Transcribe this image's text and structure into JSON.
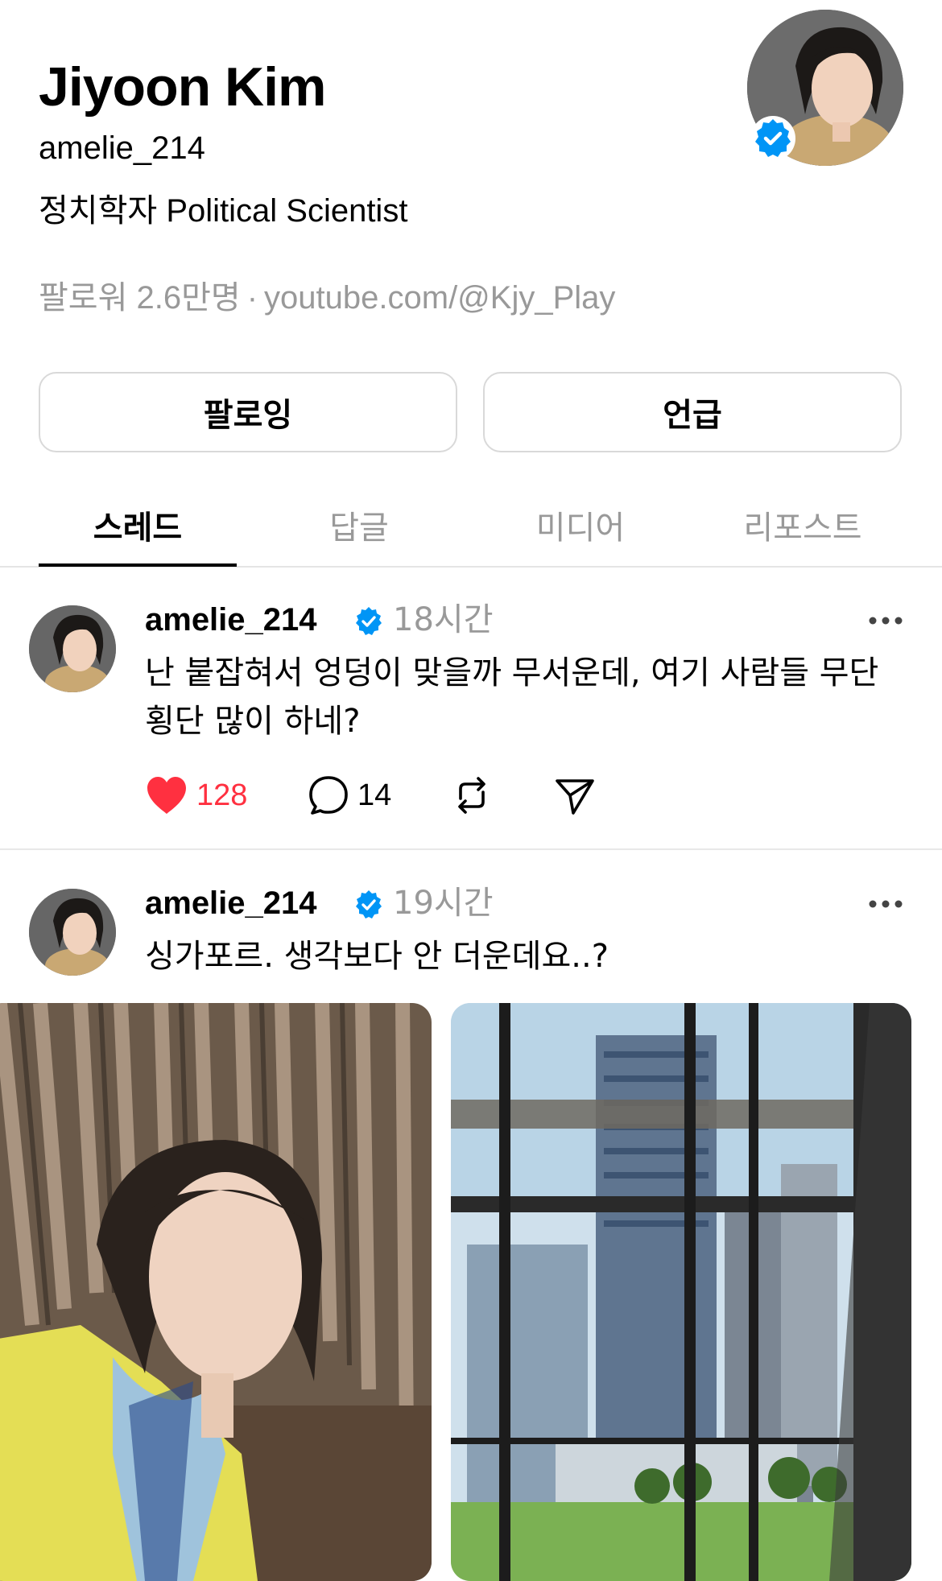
{
  "profile": {
    "name": "Jiyoon Kim",
    "handle": "amelie_214",
    "bio": "정치학자 Political Scientist",
    "followers": "팔로워 2.6만명",
    "separator": "·",
    "link": "youtube.com/@Kjy_Play"
  },
  "buttons": {
    "follow": "팔로잉",
    "mention": "언급"
  },
  "tabs": [
    {
      "label": "스레드",
      "active": true
    },
    {
      "label": "답글",
      "active": false
    },
    {
      "label": "미디어",
      "active": false
    },
    {
      "label": "리포스트",
      "active": false
    }
  ],
  "posts": [
    {
      "user": "amelie_214",
      "time": "18시간",
      "text": "난 붙잡혀서 엉덩이 맞을까 무서운데, 여기 사람들 무단횡단 많이 하네?",
      "likes": "128",
      "comments": "14"
    },
    {
      "user": "amelie_214",
      "time": "19시간",
      "text": "싱가포르. 생각보다 안 더운데요..?"
    }
  ],
  "colors": {
    "verified": "#0095f6",
    "like": "#ff3040",
    "secondary_text": "#999999"
  }
}
